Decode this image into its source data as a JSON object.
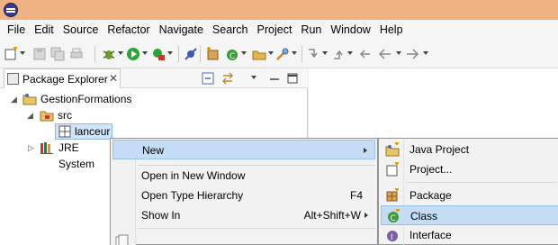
{
  "menubar": {
    "items": [
      "File",
      "Edit",
      "Source",
      "Refactor",
      "Navigate",
      "Search",
      "Project",
      "Run",
      "Window",
      "Help"
    ]
  },
  "explorer": {
    "tab_label": "Package Explorer",
    "close_glyph": "✕",
    "tree": {
      "project": "GestionFormations",
      "src": "src",
      "selected_item": "lanceur",
      "jre": "JRE System"
    }
  },
  "context_menu": {
    "new_label": "New",
    "open_new_window": "Open in New Window",
    "open_type_hierarchy": "Open Type Hierarchy",
    "open_type_hierarchy_accel": "F4",
    "show_in": "Show In",
    "show_in_accel": "Alt+Shift+W"
  },
  "submenu": {
    "java_project": "Java Project",
    "project": "Project...",
    "package": "Package",
    "class": "Class",
    "interface": "Interface"
  },
  "colors": {
    "titlebar": "#eeb283",
    "highlight": "#c4ddf5",
    "highlight_border": "#99c1ea"
  }
}
